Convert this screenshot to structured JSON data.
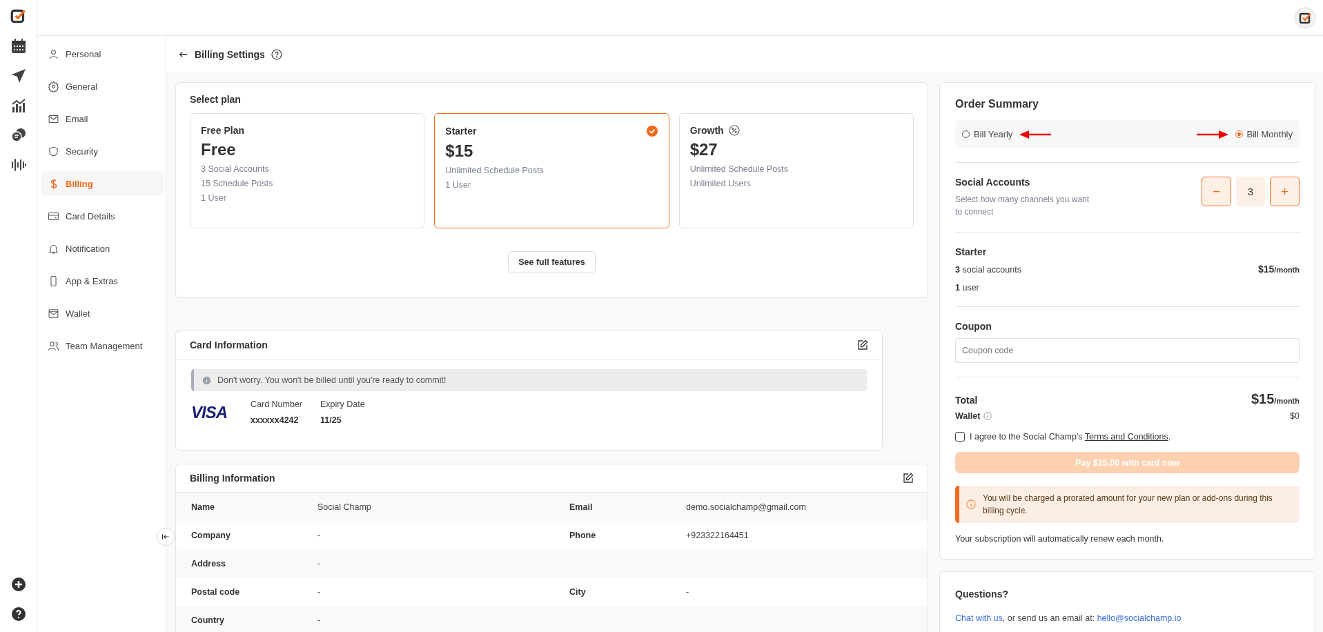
{
  "sidebar": {
    "items": [
      {
        "label": "Personal",
        "selected": false
      },
      {
        "label": "General",
        "selected": false
      },
      {
        "label": "Email",
        "selected": false
      },
      {
        "label": "Security",
        "selected": false
      },
      {
        "label": "Billing",
        "selected": true
      },
      {
        "label": "Card Details",
        "selected": false
      },
      {
        "label": "Notification",
        "selected": false
      },
      {
        "label": "App & Extras",
        "selected": false
      },
      {
        "label": "Wallet",
        "selected": false
      },
      {
        "label": "Team Management",
        "selected": false
      }
    ]
  },
  "page_title": "Billing Settings",
  "plans": {
    "title": "Select plan",
    "items": [
      {
        "name": "Free Plan",
        "price": "Free",
        "features": [
          "3 Social Accounts",
          "15 Schedule Posts",
          "1 User"
        ],
        "selected": false,
        "discount": false
      },
      {
        "name": "Starter",
        "price": "$15",
        "features": [
          "Unlimited Schedule Posts",
          "1 User"
        ],
        "selected": true,
        "discount": false
      },
      {
        "name": "Growth",
        "price": "$27",
        "features": [
          "Unlimited Schedule Posts",
          "Unlimited Users"
        ],
        "selected": false,
        "discount": true
      }
    ],
    "button": "See full features"
  },
  "card_info": {
    "title": "Card Information",
    "notice": "Don't worry. You won't be billed until you're ready to commit!",
    "brand": "VISA",
    "fields": [
      {
        "label": "Card Number",
        "value": "xxxxxx4242"
      },
      {
        "label": "Expiry Date",
        "value": "11/25"
      }
    ]
  },
  "billing_info": {
    "title": "Billing Information",
    "rows": [
      [
        {
          "label": "Name",
          "value": "Social Champ"
        },
        {
          "label": "Email",
          "value": "demo.socialchamp@gmail.com"
        }
      ],
      [
        {
          "label": "Company",
          "value": "-"
        },
        {
          "label": "Phone",
          "value": "+923322164451"
        }
      ],
      [
        {
          "label": "Address",
          "value": "-"
        }
      ],
      [
        {
          "label": "Postal code",
          "value": "-"
        },
        {
          "label": "City",
          "value": "-"
        }
      ],
      [
        {
          "label": "Country",
          "value": "-"
        }
      ]
    ]
  },
  "order_summary": {
    "title": "Order Summary",
    "billing_options": [
      {
        "label": "Bill Yearly",
        "selected": false
      },
      {
        "label": "Bill Monthly",
        "selected": true
      }
    ],
    "accounts": {
      "title": "Social Accounts",
      "description": "Select how many channels you want to connect",
      "minus": "−",
      "count": "3",
      "plus": "+"
    },
    "plan": {
      "name": "Starter",
      "lines": [
        "**3** social accounts",
        "**1** user"
      ],
      "price": "$15",
      "per": "/month"
    },
    "coupon": {
      "title": "Coupon",
      "placeholder": "Coupon code"
    },
    "total": {
      "label": "Total",
      "price": "$15",
      "per": "/month"
    },
    "wallet": {
      "label": "Wallet",
      "value": "$0"
    },
    "agree": {
      "checked": false,
      "text": "I agree to the Social Champ's ",
      "link": "Terms and Conditions",
      "end": "."
    },
    "pay_button": {
      "label": "Pay $15.00 with card now",
      "disabled": true
    },
    "alert": "You will be charged a prorated amount for your new plan or add-ons during this billing cycle.",
    "renewal": "Your subscription will automatically renew each month."
  },
  "questions": {
    "title": "Questions?",
    "link": "Chat with us",
    "text": ", or send us an email at:",
    "email": "hello@socialchamp.io"
  }
}
